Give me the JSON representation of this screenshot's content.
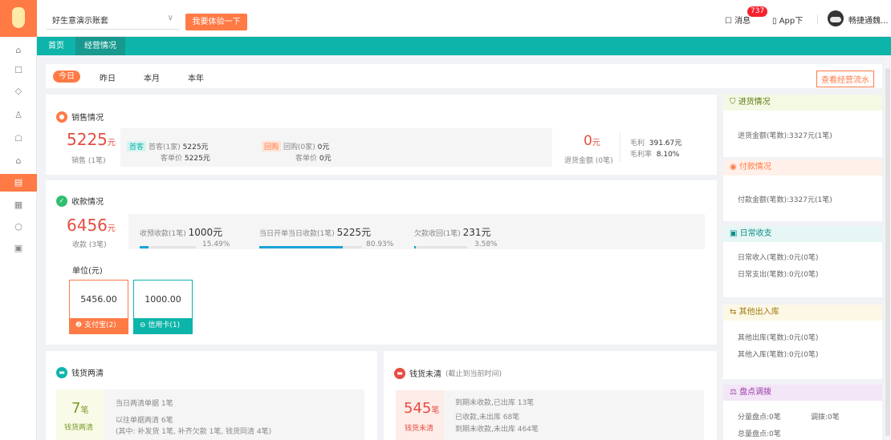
{
  "header": {
    "account": "好生意演示账套",
    "try_button": "我要体验一下",
    "messages_label": "消息",
    "messages_count": "737",
    "app_download": "App下",
    "username": "畅捷通魏..."
  },
  "tabs": [
    {
      "label": "首页"
    },
    {
      "label": "经营情况"
    }
  ],
  "periods": [
    {
      "label": "今日"
    },
    {
      "label": "昨日"
    },
    {
      "label": "本月"
    },
    {
      "label": "本年"
    }
  ],
  "flow_button": "查看经营流水",
  "sales": {
    "title": "销售情况",
    "amount": "5225",
    "unit": "元",
    "label": "销售 (1笔)",
    "first_tag": "首客",
    "first_text": "首客(1家)",
    "first_value": "5225元",
    "first_price_label": "客单价",
    "first_price_value": "5225元",
    "repeat_tag": "回购",
    "repeat_text": "回购(0家)",
    "repeat_value": "0元",
    "repeat_price_label": "客单价",
    "repeat_price_value": "0元",
    "return_amount": "0",
    "return_unit": "元",
    "return_label": "退货金额 (0笔)",
    "gross_label": "毛利",
    "gross_value": "391.67元",
    "margin_label": "毛利率",
    "margin_value": "8.10%"
  },
  "receipts": {
    "title": "收款情况",
    "amount": "6456",
    "unit": "元",
    "label": "收款 (3笔)",
    "items": [
      {
        "label": "收预收款(1笔)",
        "value": "1000元",
        "pct": "15.49%",
        "frac": 0.1549
      },
      {
        "label": "当日开单当日收款(1笔)",
        "value": "5225元",
        "pct": "80.93%",
        "frac": 0.8093
      },
      {
        "label": "欠款收回(1笔)",
        "value": "231元",
        "pct": "3.58%",
        "frac": 0.0358
      }
    ],
    "unit_label": "单位(元)",
    "methods": [
      {
        "amount": "5456.00",
        "label": "支付宝(2)"
      },
      {
        "amount": "1000.00",
        "label": "信用卡(1)"
      }
    ]
  },
  "cleared": {
    "title": "钱货两清",
    "count": "7",
    "count_unit": "笔",
    "label": "钱货两清",
    "line1": "当日两清单据 1笔",
    "line2": "以往单据两清 6笔",
    "line3": "(其中: 补发货 1笔, 补齐欠款 1笔, 钱货同清 4笔)"
  },
  "uncleared": {
    "title": "钱货未清",
    "note": "(截止到当前时间)",
    "count": "545",
    "count_unit": "笔",
    "label": "钱货未清",
    "line1": "到期未收款,已出库 13笔",
    "line2": "已收款,未出库 68笔",
    "line3": "到期未收款,未出库 464笔"
  },
  "right": {
    "purchase_title": "进货情况",
    "purchase_line": "进货金额(笔数):3327元(1笔)",
    "payment_title": "付款情况",
    "payment_line": "付款金额(笔数):3327元(1笔)",
    "daily_title": "日常收支",
    "daily_in": "日常收入(笔数):0元(0笔)",
    "daily_out": "日常支出(笔数):0元(0笔)",
    "other_title": "其他出入库",
    "other_out": "其他出库(笔数):0元(0笔)",
    "other_in": "其他入库(笔数):0元(0笔)",
    "stock_title": "盘点调拨",
    "stock_1": "分量盘点:0笔",
    "stock_2": "调拨:0笔",
    "stock_3": "总量盘点:0笔"
  },
  "colors": {
    "accent": "#ff7a45",
    "teal": "#0cb4a9",
    "blue": "#1aa3d8",
    "red": "#e54d42"
  },
  "sidebar_icons": [
    "home-icon",
    "gift-icon",
    "box-icon",
    "bag-icon",
    "lock-icon",
    "doc-icon",
    "report-icon",
    "refresh-icon",
    "list-icon"
  ]
}
